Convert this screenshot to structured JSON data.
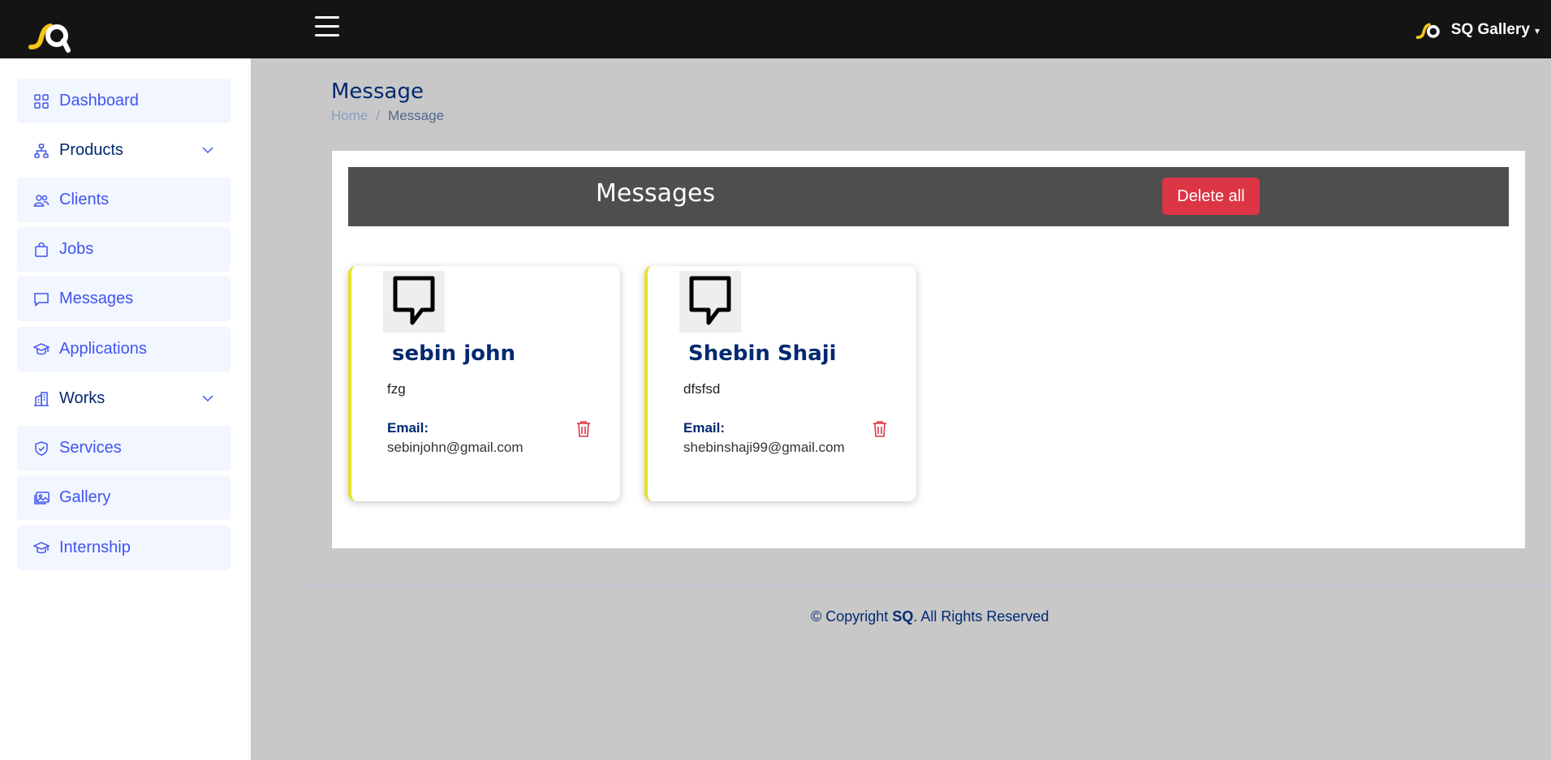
{
  "topbar": {
    "user_name": "SQ Gallery",
    "caret": "▾"
  },
  "sidebar": {
    "items": [
      {
        "label": "Dashboard",
        "icon": "grid-icon"
      },
      {
        "label": "Products",
        "icon": "diagram-icon",
        "expandable": true
      },
      {
        "label": "Clients",
        "icon": "people-icon"
      },
      {
        "label": "Jobs",
        "icon": "bag-icon"
      },
      {
        "label": "Messages",
        "icon": "chat-icon"
      },
      {
        "label": "Applications",
        "icon": "mortarboard-icon"
      },
      {
        "label": "Works",
        "icon": "buildings-icon",
        "expandable": true
      },
      {
        "label": "Services",
        "icon": "shield-check-icon"
      },
      {
        "label": "Gallery",
        "icon": "images-icon"
      },
      {
        "label": "Internship",
        "icon": "mortarboard-icon"
      }
    ]
  },
  "page": {
    "title": "Message",
    "breadcrumb": {
      "home": "Home",
      "separator": "/",
      "current": "Message"
    }
  },
  "panel": {
    "header_title": "Messages",
    "delete_all_label": "Delete all"
  },
  "messages": [
    {
      "name": "sebin john",
      "text": "fzg",
      "email_label": "Email:",
      "email": "sebinjohn@gmail.com"
    },
    {
      "name": "Shebin Shaji",
      "text": "dfsfsd",
      "email_label": "Email:",
      "email": "shebinshaji99@gmail.com"
    }
  ],
  "footer": {
    "prefix": "© Copyright ",
    "brand": "SQ",
    "suffix": ". All Rights Reserved"
  },
  "colors": {
    "accent": "#4154f1",
    "navy": "#012970",
    "danger": "#dc3545",
    "topbar": "#141414",
    "card_border": "#e6e02b",
    "logo_yellow": "#f5c518"
  }
}
